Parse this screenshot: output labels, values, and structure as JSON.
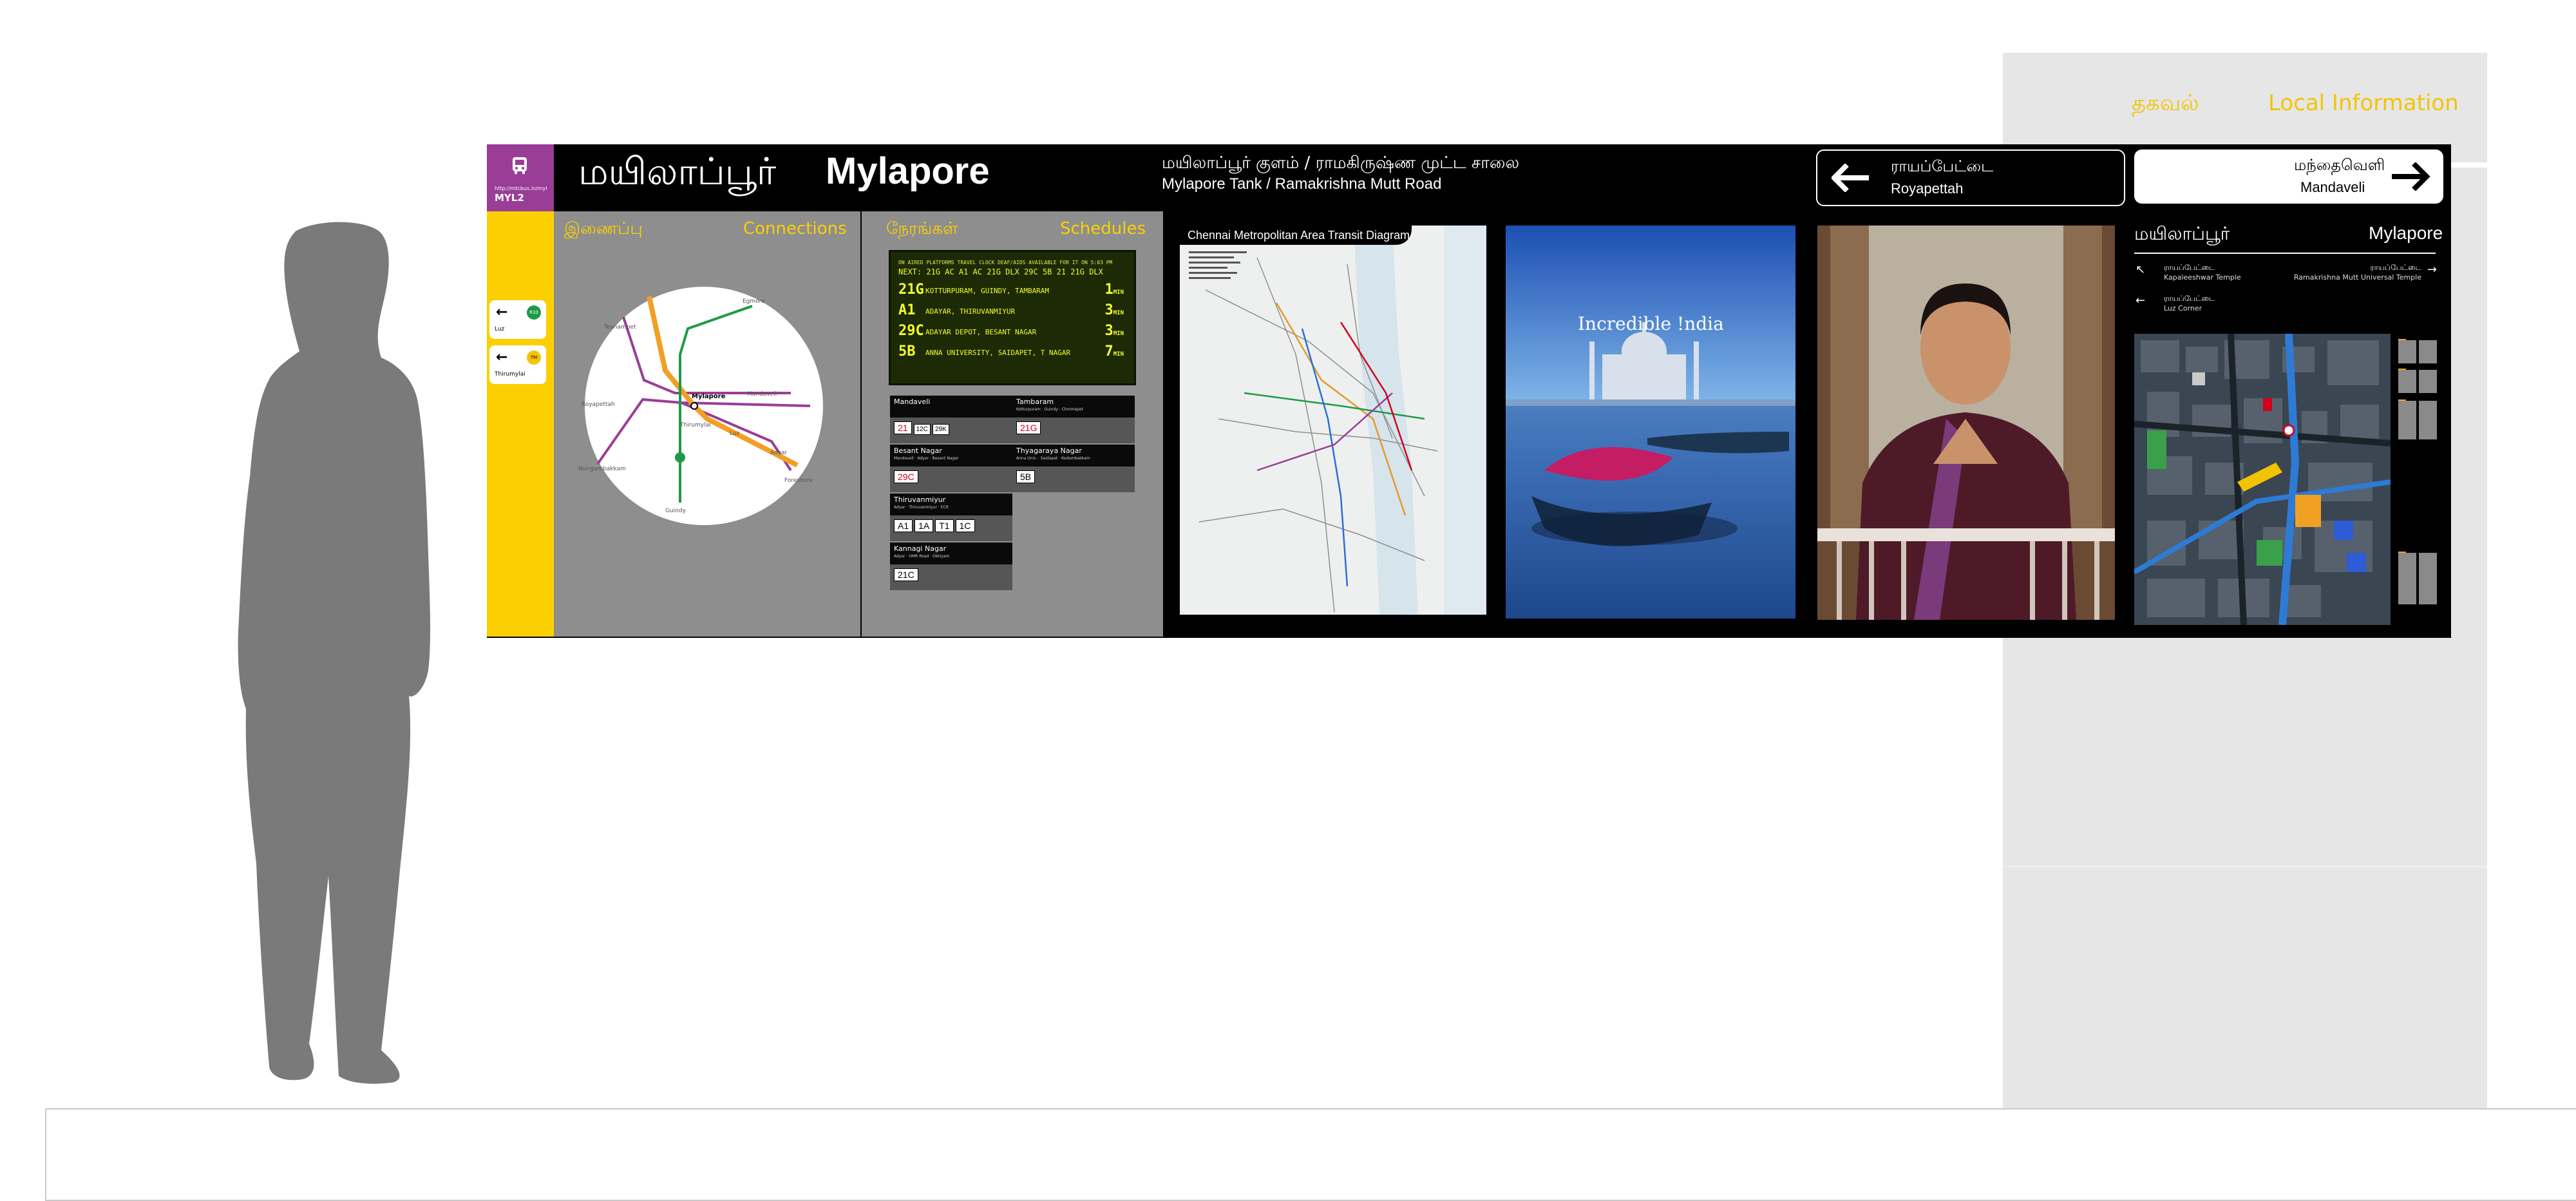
{
  "info_column": {
    "tamil_label": "தகவல்",
    "english_label": "Local Information"
  },
  "stop": {
    "code": "MYL2",
    "url": "http://mtcbus.in/myl",
    "name_tamil": "மயிலாப்பூர்",
    "name_english": "Mylapore",
    "location_tamil": "மயிலாப்பூர் குளம்  /  ராமகிருஷ்ண முட்ட சாலை",
    "location_english": "Mylapore Tank / Ramakrishna Mutt Road"
  },
  "side_cards": [
    {
      "label": "Luz",
      "badge": "R33",
      "color": "#1e9a46"
    },
    {
      "label": "Thirumylai",
      "badge": "TM",
      "color": "#f3c400"
    }
  ],
  "connections": {
    "title_tamil": "இணைப்பு",
    "title_english": "Connections",
    "map_labels": {
      "mylapore": "Mylapore",
      "mandaveli": "Mandaveli",
      "thirumylai": "Thirumylai",
      "luz": "Luz",
      "royapettah": "Royapettah",
      "egmore": "Egmore",
      "teynampet": "Teynampet",
      "nungambakkam": "Nungambakkam",
      "guindy": "Guindy",
      "adyar": "Adyar",
      "foreshore": "Foreshore"
    }
  },
  "schedules": {
    "title_tamil": "நேரங்கள்",
    "title_english": "Schedules",
    "led_header": "ON AIRED PLATFORMS TRAVEL   CLOCK   DEAF/AIDS AVAILABLE FOR IT   ON   5:03 PM",
    "led_next": "NEXT: 21G AC   A1 AC   21G DLX   29C   5B   21   21G DLX",
    "arrivals": [
      {
        "route": "21G",
        "destination": "KOTTURPURAM, GUINDY, TAMBARAM",
        "minutes": "1",
        "unit": "MIN"
      },
      {
        "route": "A1",
        "destination": "ADAYAR, THIRUVANMIYUR",
        "minutes": "3",
        "unit": "MIN"
      },
      {
        "route": "29C",
        "destination": "ADAYAR DEPOT, BESANT NAGAR",
        "minutes": "3",
        "unit": "MIN"
      },
      {
        "route": "5B",
        "destination": "ANNA UNIVERSITY, SAIDAPET, T NAGAR",
        "minutes": "7",
        "unit": "MIN"
      }
    ],
    "destinations": [
      {
        "name": "Mandaveli",
        "sub": "",
        "routes": [
          {
            "r": "21",
            "red": true
          },
          {
            "r": "12C",
            "red": false,
            "sm": true
          },
          {
            "r": "29K",
            "red": false,
            "sm": true
          }
        ]
      },
      {
        "name": "Tambaram",
        "sub": "Kotturpuram · Guindy · Chromepet",
        "routes": [
          {
            "r": "21G",
            "red": true
          }
        ]
      },
      {
        "name": "Besant Nagar",
        "sub": "Mandaveli · Adyar · Besant Nagar",
        "routes": [
          {
            "r": "29C",
            "red": true
          }
        ]
      },
      {
        "name": "Thyagaraya Nagar",
        "sub": "Anna Univ. · Saidapet · Kodambakkam",
        "routes": [
          {
            "r": "5B",
            "red": false
          }
        ]
      },
      {
        "name": "Thiruvanmiyur",
        "sub": "Adyar · Thiruvanmiyur · ECR",
        "routes": [
          {
            "r": "A1",
            "red": false
          },
          {
            "r": "1A",
            "red": false
          },
          {
            "r": "T1",
            "red": false
          },
          {
            "r": "1C",
            "red": false
          }
        ]
      },
      {
        "name": "Kannagi Nagar",
        "sub": "Adyar · OMR Road · Okkiyam",
        "routes": [
          {
            "r": "21C",
            "red": false
          }
        ]
      }
    ]
  },
  "directions": {
    "left": {
      "tamil": "ராயப்பேட்டை",
      "english": "Royapettah"
    },
    "right": {
      "tamil": "மந்தைவெளி",
      "english": "Mandaveli"
    }
  },
  "transit_map": {
    "title": "Chennai Metropolitan Area Transit Diagram"
  },
  "taj_poster": {
    "headline": "Incredible !ndia"
  },
  "neighborhood": {
    "title_tamil": "மயிலாப்பூர்",
    "title_english": "Mylapore",
    "places": [
      {
        "tamil": "ராயப்பேட்டை",
        "english": "Kapaleeshwar Temple",
        "dir": "up-left"
      },
      {
        "tamil": "ராயப்பேட்டை",
        "english": "Ramakrishna Mutt Universal Temple",
        "dir": "right"
      },
      {
        "tamil": "ராயப்பேட்டை",
        "english": "Luz Corner",
        "dir": "left"
      }
    ]
  },
  "colors": {
    "board": "#000000",
    "yellow": "#fcd000",
    "purple": "#9a3d96",
    "panel_grey": "#8e8e8e",
    "info_grey": "#e6e6e6",
    "silhouette": "#7a7a7a"
  }
}
